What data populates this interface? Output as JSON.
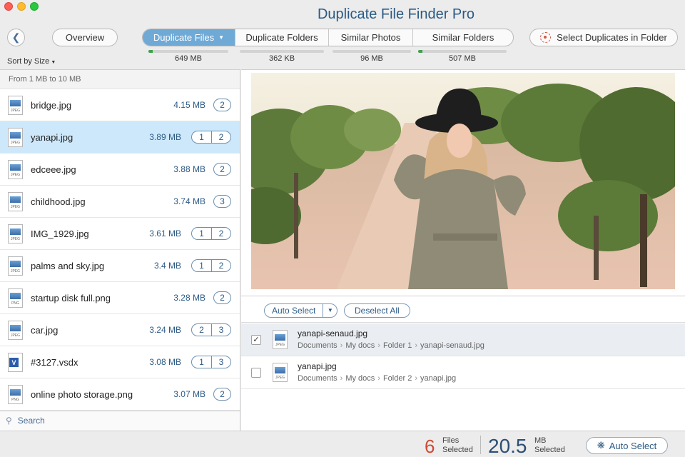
{
  "window": {
    "title": "Duplicate File Finder Pro"
  },
  "toolbar": {
    "back_icon": "chevron-left-icon",
    "overview_label": "Overview",
    "tabs": [
      {
        "label": "Duplicate Files",
        "active": true,
        "size": "649 MB",
        "fill": 0.05
      },
      {
        "label": "Duplicate Folders",
        "active": false,
        "size": "362 KB",
        "fill": 0.0
      },
      {
        "label": "Similar Photos",
        "active": false,
        "size": "96 MB",
        "fill": 0.0
      },
      {
        "label": "Similar Folders",
        "active": false,
        "size": "507 MB",
        "fill": 0.05
      }
    ],
    "select_duplicates_label": "Select Duplicates in Folder"
  },
  "sort": {
    "label": "Sort by Size"
  },
  "file_list": {
    "group_header": "From 1 MB to 10 MB",
    "items": [
      {
        "name": "bridge.jpg",
        "size": "4.15 MB",
        "counts": [
          "2"
        ],
        "type": "JPEG",
        "selected": false
      },
      {
        "name": "yanapi.jpg",
        "size": "3.89 MB",
        "counts": [
          "1",
          "2"
        ],
        "type": "JPEG",
        "selected": true
      },
      {
        "name": "edceee.jpg",
        "size": "3.88 MB",
        "counts": [
          "2"
        ],
        "type": "JPEG",
        "selected": false
      },
      {
        "name": "childhood.jpg",
        "size": "3.74 MB",
        "counts": [
          "3"
        ],
        "type": "JPEG",
        "selected": false
      },
      {
        "name": "IMG_1929.jpg",
        "size": "3.61 MB",
        "counts": [
          "1",
          "2"
        ],
        "type": "JPEG",
        "selected": false
      },
      {
        "name": "palms and sky.jpg",
        "size": "3.4 MB",
        "counts": [
          "1",
          "2"
        ],
        "type": "JPEG",
        "selected": false
      },
      {
        "name": "startup disk full.png",
        "size": "3.28 MB",
        "counts": [
          "2"
        ],
        "type": "PNG",
        "selected": false
      },
      {
        "name": "car.jpg",
        "size": "3.24 MB",
        "counts": [
          "2",
          "3"
        ],
        "type": "JPEG",
        "selected": false
      },
      {
        "name": "#3127.vsdx",
        "size": "3.08 MB",
        "counts": [
          "1",
          "3"
        ],
        "type": "VSDX",
        "selected": false
      },
      {
        "name": "online photo storage.png",
        "size": "3.07 MB",
        "counts": [
          "2"
        ],
        "type": "PNG",
        "selected": false
      }
    ],
    "search_label": "Search"
  },
  "detail": {
    "auto_select_label": "Auto Select",
    "deselect_all_label": "Deselect All",
    "duplicates": [
      {
        "name": "yanapi-senaud.jpg",
        "checked": true,
        "path": [
          "Documents",
          "My docs",
          "Folder 1",
          "yanapi-senaud.jpg"
        ]
      },
      {
        "name": "yanapi.jpg",
        "checked": false,
        "path": [
          "Documents",
          "My docs",
          "Folder 2",
          "yanapi.jpg"
        ]
      }
    ]
  },
  "status": {
    "files_count": "6",
    "files_label_1": "Files",
    "files_label_2": "Selected",
    "size_value": "20.5",
    "size_label_1": "MB",
    "size_label_2": "Selected",
    "auto_select_label": "Auto Select"
  }
}
